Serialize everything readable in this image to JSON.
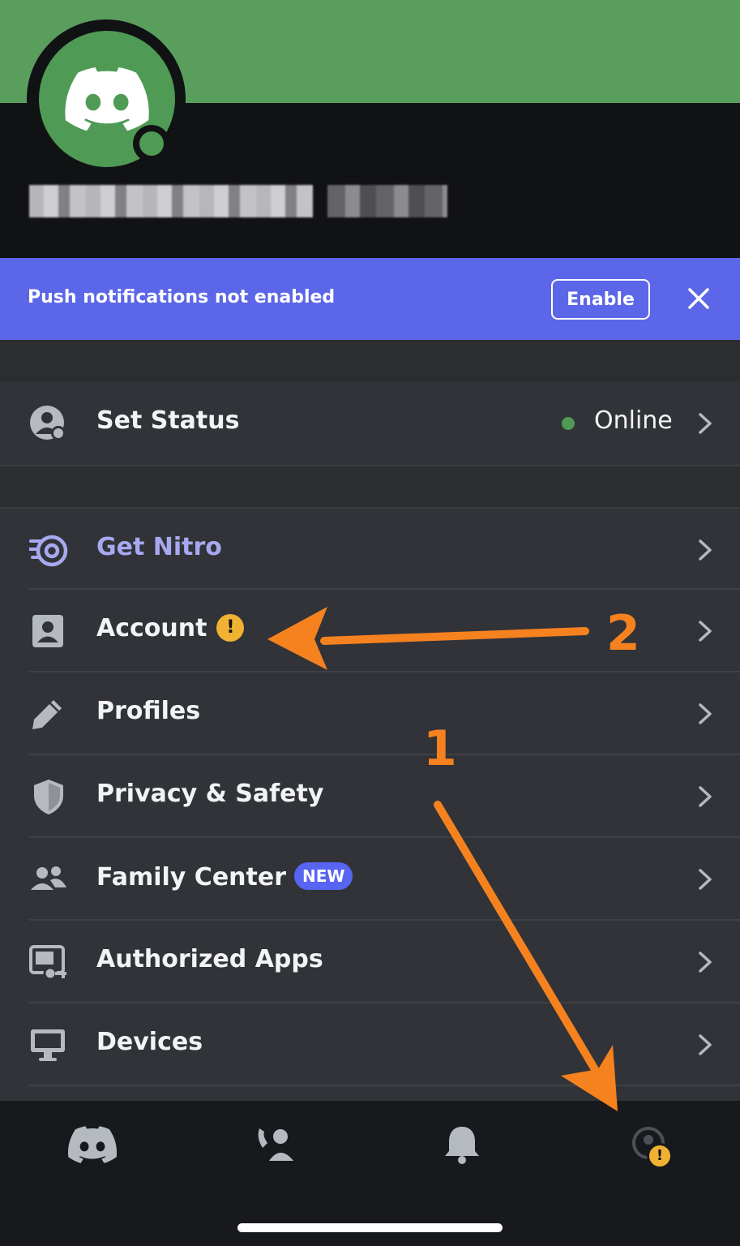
{
  "colors": {
    "brand_green": "#5a9e5e",
    "blurple": "#5c66e8",
    "nitro": "#a7a9f0",
    "warning": "#f0b232",
    "annotation": "#f5821f"
  },
  "profile": {
    "avatar_icon": "discord-logo-icon",
    "status": "online"
  },
  "notice": {
    "text": "Push notifications not enabled",
    "enable_label": "Enable",
    "close_icon": "close-icon"
  },
  "status_row": {
    "label": "Set Status",
    "value": "Online"
  },
  "menu": {
    "nitro": "Get Nitro",
    "account": "Account",
    "account_badge": "!",
    "profiles": "Profiles",
    "privacy": "Privacy & Safety",
    "family": "Family Center",
    "family_badge": "NEW",
    "authorized_apps": "Authorized Apps",
    "devices": "Devices"
  },
  "tabbar": {
    "items": [
      "home-icon",
      "friends-icon",
      "notifications-icon",
      "profile-icon"
    ],
    "profile_badge": "!"
  },
  "annotations": {
    "step1": "1",
    "step2": "2"
  }
}
